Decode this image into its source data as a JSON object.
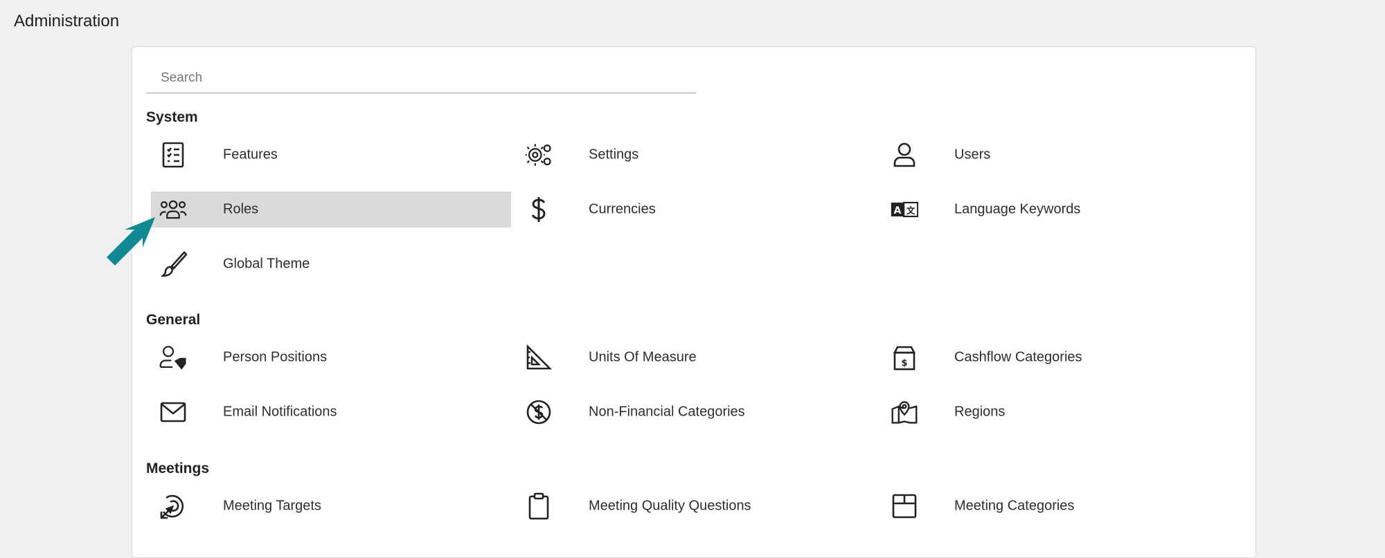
{
  "page": {
    "title": "Administration"
  },
  "search": {
    "placeholder": "Search",
    "value": ""
  },
  "sections": [
    {
      "title": "System"
    },
    {
      "title": "General"
    },
    {
      "title": "Meetings"
    }
  ],
  "items": {
    "features": {
      "label": "Features",
      "icon": "checklist-icon"
    },
    "settings": {
      "label": "Settings",
      "icon": "gears-icon"
    },
    "users": {
      "label": "Users",
      "icon": "user-icon"
    },
    "roles": {
      "label": "Roles",
      "icon": "users-group-icon",
      "highlighted": true
    },
    "currencies": {
      "label": "Currencies",
      "icon": "dollar-icon"
    },
    "language_keywords": {
      "label": "Language Keywords",
      "icon": "translate-icon"
    },
    "global_theme": {
      "label": "Global Theme",
      "icon": "brush-icon"
    },
    "person_positions": {
      "label": "Person Positions",
      "icon": "user-tag-icon"
    },
    "units_of_measure": {
      "label": "Units Of Measure",
      "icon": "ruler-triangle-icon"
    },
    "cashflow_categories": {
      "label": "Cashflow Categories",
      "icon": "money-box-icon"
    },
    "email_notifications": {
      "label": "Email Notifications",
      "icon": "envelope-icon"
    },
    "non_financial_categories": {
      "label": "Non-Financial Categories",
      "icon": "no-dollar-icon"
    },
    "regions": {
      "label": "Regions",
      "icon": "map-pin-icon"
    },
    "meeting_targets": {
      "label": "Meeting Targets",
      "icon": "target-arrow-icon"
    },
    "meeting_quality_questions": {
      "label": "Meeting Quality Questions",
      "icon": "clipboard-icon"
    },
    "meeting_categories": {
      "label": "Meeting Categories",
      "icon": "box-icon"
    }
  },
  "colors": {
    "arrow": "#0f8a93",
    "highlight": "#dadada",
    "background": "#f0f0f0"
  }
}
